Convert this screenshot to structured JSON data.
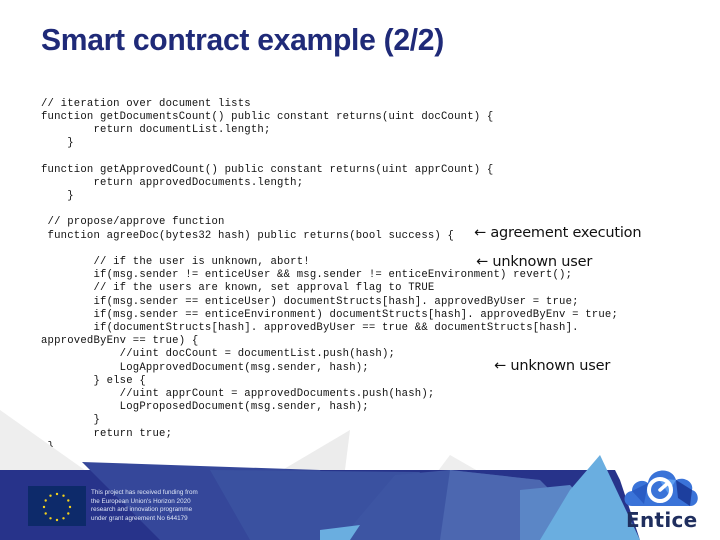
{
  "slide": {
    "title": "Smart contract example (2/2)"
  },
  "code": {
    "lines": [
      "// iteration over document lists",
      "function getDocumentsCount() public constant returns(uint docCount) {",
      "        return documentList.length;",
      "    }",
      "function getApprovedCount() public constant returns(uint apprCount) {",
      "        return approvedDocuments.length;",
      "    }",
      " // propose/approve function",
      " function agreeDoc(bytes32 hash) public returns(bool success) {",
      "        // if the user is unknown, abort!",
      "        if(msg.sender != enticeUser && msg.sender != enticeEnvironment) revert();",
      "        // if the users are known, set approval flag to TRUE",
      "        if(msg.sender == enticeUser) documentStructs[hash]. approvedByUser = true;",
      "        if(msg.sender == enticeEnvironment) documentStructs[hash]. approvedByEnv = true;",
      "        if(documentStructs[hash]. approvedByUser == true && documentStructs[hash].",
      "approvedByEnv == true) {",
      "            //uint docCount = documentList.push(hash);",
      "            LogApprovedDocument(msg.sender, hash);",
      "        } else {",
      "            //uint apprCount = approvedDocuments.push(hash);",
      "            LogProposedDocument(msg.sender, hash);",
      "        }",
      "        return true;",
      " }",
      "}"
    ]
  },
  "annotations": [
    {
      "arrow": "←",
      "text": "← agreement execution"
    },
    {
      "arrow": "←",
      "text": "← unknown user"
    },
    {
      "arrow": "←",
      "text": "← unknown user"
    }
  ],
  "footer": {
    "funding_text": "This project has received funding from\nthe European Union's Horizon 2020\nresearch and innovation programme\nunder grant agreement No 644179",
    "logo_wordmark": "Entice",
    "colors": {
      "title": "#1f2a78",
      "footer_dark": "#27338a",
      "footer_mid": "#3f5aa6",
      "footer_light": "#6aaee0",
      "eu_blue": "#0d2a6a",
      "eu_star": "#f4d21a"
    }
  }
}
